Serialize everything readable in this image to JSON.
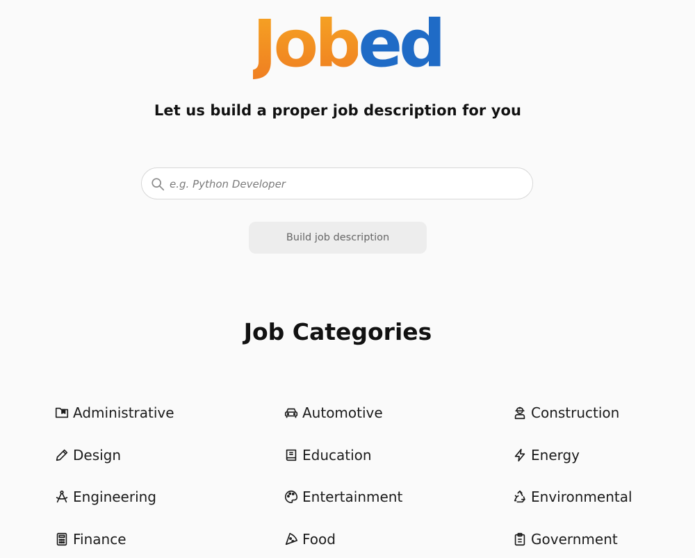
{
  "brand": {
    "logo_part_a": "Job",
    "logo_part_b": "ed",
    "logo_colors": {
      "orange": "#f39222",
      "blue": "#1f6bc6"
    }
  },
  "hero": {
    "tagline": "Let us build a proper job description for you"
  },
  "search": {
    "placeholder": "e.g. Python Developer",
    "value": "",
    "icon": "search-icon"
  },
  "build_button": {
    "label": "Build job description"
  },
  "categories_section": {
    "title": "Job Categories",
    "items": [
      {
        "label": "Administrative",
        "icon": "folder-icon"
      },
      {
        "label": "Automotive",
        "icon": "car-icon"
      },
      {
        "label": "Construction",
        "icon": "hard-hat-worker-icon"
      },
      {
        "label": "Design",
        "icon": "pencil-icon"
      },
      {
        "label": "Education",
        "icon": "book-icon"
      },
      {
        "label": "Energy",
        "icon": "lightning-bolt-icon"
      },
      {
        "label": "Engineering",
        "icon": "compass-drafting-icon"
      },
      {
        "label": "Entertainment",
        "icon": "palette-icon"
      },
      {
        "label": "Environmental",
        "icon": "recycle-icon"
      },
      {
        "label": "Finance",
        "icon": "calculator-icon"
      },
      {
        "label": "Food",
        "icon": "pizza-slice-icon"
      },
      {
        "label": "Government",
        "icon": "clipboard-icon"
      }
    ]
  }
}
